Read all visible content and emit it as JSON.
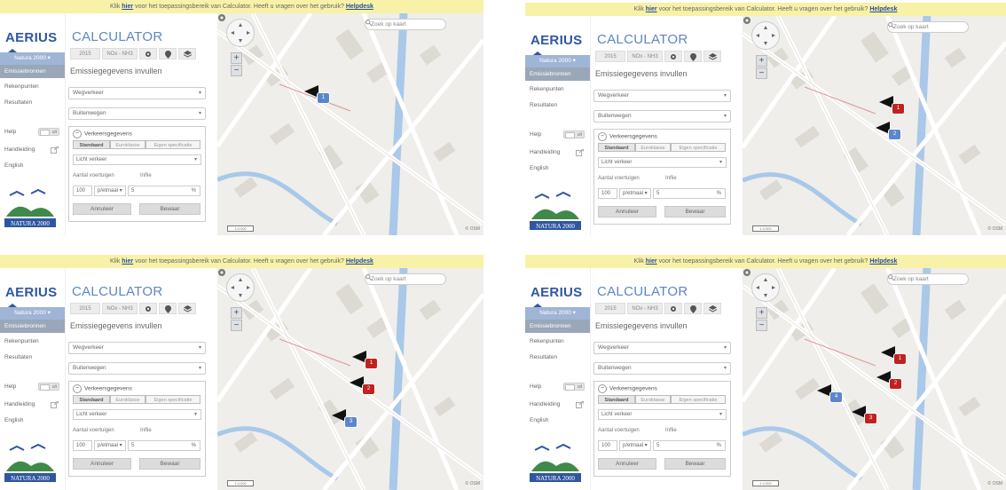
{
  "screens": [
    {
      "name": "screen-1",
      "banner": {
        "prefix": "Klik ",
        "link": "hier",
        "middle": " voor het toepassingsbereik van Calculator. Heeft u vragen over het gebruik? ",
        "help": "Helpdesk"
      },
      "logo": "AERIUS",
      "year": "Natura 2000",
      "nav": [
        "Emissiebronnen",
        "Rekenpunten",
        "Resultaten"
      ],
      "help": {
        "label": "Help",
        "toggle": "uit"
      },
      "manual": "Handleiding",
      "language": "English",
      "calc_title": "CALCULATOR",
      "toolbar": {
        "year": "2015",
        "substance": "NOx - NH3"
      },
      "section_title": "Emissiegegevens invullen",
      "sector": "Wegverkeer",
      "road_type": "Buitenwegen",
      "traffic": {
        "title": "Verkeersgegevens",
        "tabs": [
          "Standaard",
          "Eurоklasse",
          "Eigen specificatie"
        ],
        "vehicle": "Licht verkeer",
        "count_label": "Aantal voertuigen",
        "share_label": "Inflie",
        "count_value": "100",
        "period": "p/etmaal",
        "share_value": "5",
        "unit": "%"
      },
      "buttons": {
        "cancel": "Annuleer",
        "save": "Bewaar"
      },
      "search_placeholder": "Zoek op kaart",
      "scale_label": "1:4.000",
      "copyright": "© OSM",
      "markers": [
        {
          "label": "1",
          "color": "blue"
        }
      ]
    },
    {
      "name": "screen-2",
      "banner": {
        "prefix": "Klik ",
        "link": "hier",
        "middle": " voor het toepassingsbereik van Calculator. Heeft u vragen over het gebruik? ",
        "help": "Helpdesk"
      },
      "logo": "AERIUS",
      "year": "Natura 2000",
      "nav": [
        "Emissiebronnen",
        "Rekenpunten",
        "Resultaten"
      ],
      "help": {
        "label": "Help",
        "toggle": "uit"
      },
      "manual": "Handleiding",
      "language": "English",
      "calc_title": "CALCULATOR",
      "toolbar": {
        "year": "2015",
        "substance": "NOx - NH3"
      },
      "section_title": "Emissiegegevens invullen",
      "sector": "Wegverkeer",
      "road_type": "Buitenwegen",
      "traffic": {
        "title": "Verkeersgegevens",
        "tabs": [
          "Standaard",
          "Euroklasse",
          "Eigen specificatie"
        ],
        "vehicle": "Licht verkeer",
        "count_label": "Aantal voertuigen",
        "share_label": "Inflie",
        "count_value": "100",
        "period": "p/etmaal",
        "share_value": "5",
        "unit": "%"
      },
      "buttons": {
        "cancel": "Annuleer",
        "save": "Bewaar"
      },
      "search_placeholder": "Zoek op kaart",
      "scale_label": "1:4.000",
      "copyright": "© OSM",
      "markers": [
        {
          "label": "1",
          "color": "red"
        },
        {
          "label": "2",
          "color": "blue"
        }
      ]
    },
    {
      "name": "screen-3",
      "banner": {
        "prefix": "Klik ",
        "link": "hier",
        "middle": " voor het toepassingsbereik van Calculator. Heeft u vragen over het gebruik? ",
        "help": "Helpdesk"
      },
      "logo": "AERIUS",
      "year": "Natura 2000",
      "nav": [
        "Emissiebronnen",
        "Rekenpunten",
        "Resultaten"
      ],
      "help": {
        "label": "Help",
        "toggle": "uit"
      },
      "manual": "Handleiding",
      "language": "English",
      "calc_title": "CALCULATOR",
      "toolbar": {
        "year": "2015",
        "substance": "NOx - NH3"
      },
      "section_title": "Emissiegegevens invullen",
      "sector": "Wegverkeer",
      "road_type": "Buitenwegen",
      "traffic": {
        "title": "Verkeersgegevens",
        "tabs": [
          "Standaard",
          "Euroklasse",
          "Eigen specificatie"
        ],
        "vehicle": "Licht verkeer",
        "count_label": "Aantal voertuigen",
        "share_label": "Inflie",
        "count_value": "100",
        "period": "p/etmaal",
        "share_value": "5",
        "unit": "%"
      },
      "buttons": {
        "cancel": "Annuleer",
        "save": "Bewaar"
      },
      "search_placeholder": "Zoek op kaart",
      "scale_label": "1:4.000",
      "copyright": "© OSM",
      "markers": [
        {
          "label": "1",
          "color": "red"
        },
        {
          "label": "2",
          "color": "red"
        },
        {
          "label": "3",
          "color": "blue"
        }
      ]
    },
    {
      "name": "screen-4",
      "banner": {
        "prefix": "Klik ",
        "link": "hier",
        "middle": " voor het toepassingsbereik van Calculator. Heeft u vragen over het gebruik? ",
        "help": "Helpdesk"
      },
      "logo": "AERIUS",
      "year": "Natura 2000",
      "nav": [
        "Emissiebronnen",
        "Rekenpunten",
        "Resultaten"
      ],
      "help": {
        "label": "Help",
        "toggle": "uit"
      },
      "manual": "Handleiding",
      "language": "English",
      "calc_title": "CALCULATOR",
      "toolbar": {
        "year": "2015",
        "substance": "NOx - NH3"
      },
      "section_title": "Emissiegegevens invullen",
      "sector": "Wegverkeer",
      "road_type": "Buitenwegen",
      "traffic": {
        "title": "Verkeersgegevens",
        "tabs": [
          "Standaard",
          "Euroklasse",
          "Eigen specificatie"
        ],
        "vehicle": "Licht verkeer",
        "count_label": "Aantal voertuigen",
        "share_label": "Inflie",
        "count_value": "100",
        "period": "p/etmaal",
        "share_value": "5",
        "unit": "%"
      },
      "buttons": {
        "cancel": "Annuleer",
        "save": "Bewaar"
      },
      "search_placeholder": "Zoek op kaart",
      "scale_label": "1:4.000",
      "copyright": "© OSM",
      "markers": [
        {
          "label": "1",
          "color": "red"
        },
        {
          "label": "2",
          "color": "red"
        },
        {
          "label": "3",
          "color": "red"
        },
        {
          "label": "4",
          "color": "blue"
        }
      ]
    }
  ],
  "colors": {
    "banner": "#f7f2a8",
    "brand": "#2f56a0",
    "calc": "#5d86c4",
    "marker_red": "#c0221f",
    "marker_blue": "#5c86cc",
    "water": "#a9c8ea",
    "road": "#ffffff"
  }
}
